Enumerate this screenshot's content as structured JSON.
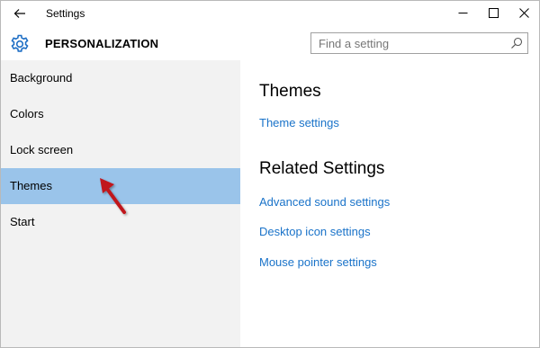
{
  "window": {
    "title": "Settings"
  },
  "header": {
    "section_title": "PERSONALIZATION",
    "search_placeholder": "Find a setting"
  },
  "sidebar": {
    "items": [
      {
        "label": "Background",
        "selected": false
      },
      {
        "label": "Colors",
        "selected": false
      },
      {
        "label": "Lock screen",
        "selected": false
      },
      {
        "label": "Themes",
        "selected": true
      },
      {
        "label": "Start",
        "selected": false
      }
    ]
  },
  "content": {
    "themes_heading": "Themes",
    "theme_settings_link": "Theme settings",
    "related_heading": "Related Settings",
    "related_links": [
      "Advanced sound settings",
      "Desktop icon settings",
      "Mouse pointer settings"
    ]
  },
  "colors": {
    "selected_bg": "#9ac4ea",
    "sidebar_bg": "#f2f2f2",
    "link": "#1a73c9",
    "accent_icon": "#1f6fc5",
    "annotation_arrow": "#c0161b"
  },
  "icons": {
    "back": "back-arrow-icon",
    "gear": "gear-icon",
    "search": "search-icon",
    "minimize": "minimize-icon",
    "maximize": "maximize-icon",
    "close": "close-icon",
    "annotation": "annotation-arrow"
  }
}
